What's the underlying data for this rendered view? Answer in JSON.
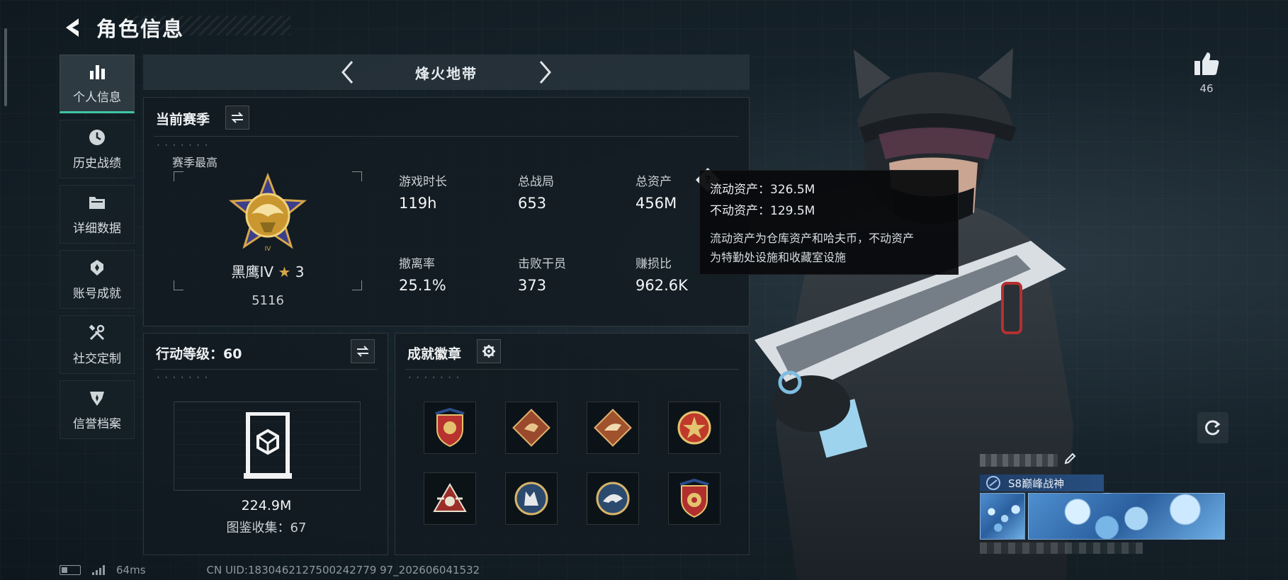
{
  "header": {
    "title": "角色信息"
  },
  "sidenav": {
    "items": [
      {
        "label": "个人信息",
        "icon": "bar-chart-icon",
        "active": true
      },
      {
        "label": "历史战绩",
        "icon": "clock-icon",
        "active": false
      },
      {
        "label": "详细数据",
        "icon": "folder-icon",
        "active": false
      },
      {
        "label": "账号成就",
        "icon": "medal-icon",
        "active": false
      },
      {
        "label": "社交定制",
        "icon": "tools-icon",
        "active": false
      },
      {
        "label": "信誉档案",
        "icon": "shield-icon",
        "active": false
      }
    ]
  },
  "season_bar": {
    "name": "烽火地带"
  },
  "season_panel": {
    "title": "当前赛季",
    "best_label": "赛季最高",
    "rank_name": "黑鹰IV",
    "rank_stars": "3",
    "rank_score": "5116",
    "stats": [
      {
        "label": "游戏时长",
        "value": "119h"
      },
      {
        "label": "总战局",
        "value": "653"
      },
      {
        "label": "总资产",
        "value": "456M"
      },
      {
        "label": "撤离率",
        "value": "25.1%"
      },
      {
        "label": "击败干员",
        "value": "373"
      },
      {
        "label": "赚损比",
        "value": "962.6K"
      }
    ]
  },
  "tooltip": {
    "liquid": "流动资产：326.5M",
    "fixed": "不动资产：129.5M",
    "desc_line1": "流动资产为仓库资产和哈夫币，不动资产",
    "desc_line2": "为特勤处设施和收藏室设施"
  },
  "action_panel": {
    "title": "行动等级：60",
    "value": "224.9M",
    "collection": "图鉴收集：67"
  },
  "badge_panel": {
    "title": "成就徽章",
    "badges": [
      {
        "icon": "shield-eagle-badge-icon",
        "color": "#b8322e"
      },
      {
        "icon": "dragon-badge-icon",
        "color": "#9a4a2c"
      },
      {
        "icon": "raptor-badge-icon",
        "color": "#a0522d"
      },
      {
        "icon": "star-badge-icon",
        "color": "#c0392b"
      },
      {
        "icon": "skull-wings-badge-icon",
        "color": "#9c2e2a"
      },
      {
        "icon": "wolf-badge-icon",
        "color": "#2c4a6e"
      },
      {
        "icon": "eagle-badge-icon",
        "color": "#2c4a6e"
      },
      {
        "icon": "crest-badge-icon",
        "color": "#b22f2f"
      }
    ]
  },
  "right": {
    "like_count": "46",
    "title_tag": "S8巅峰战神"
  },
  "footer": {
    "ping": "64ms",
    "uid": "CN UID:1830462127500242779 97_202606041532"
  },
  "colors": {
    "accent": "#3fc4a6",
    "gold": "#d7a64a"
  }
}
